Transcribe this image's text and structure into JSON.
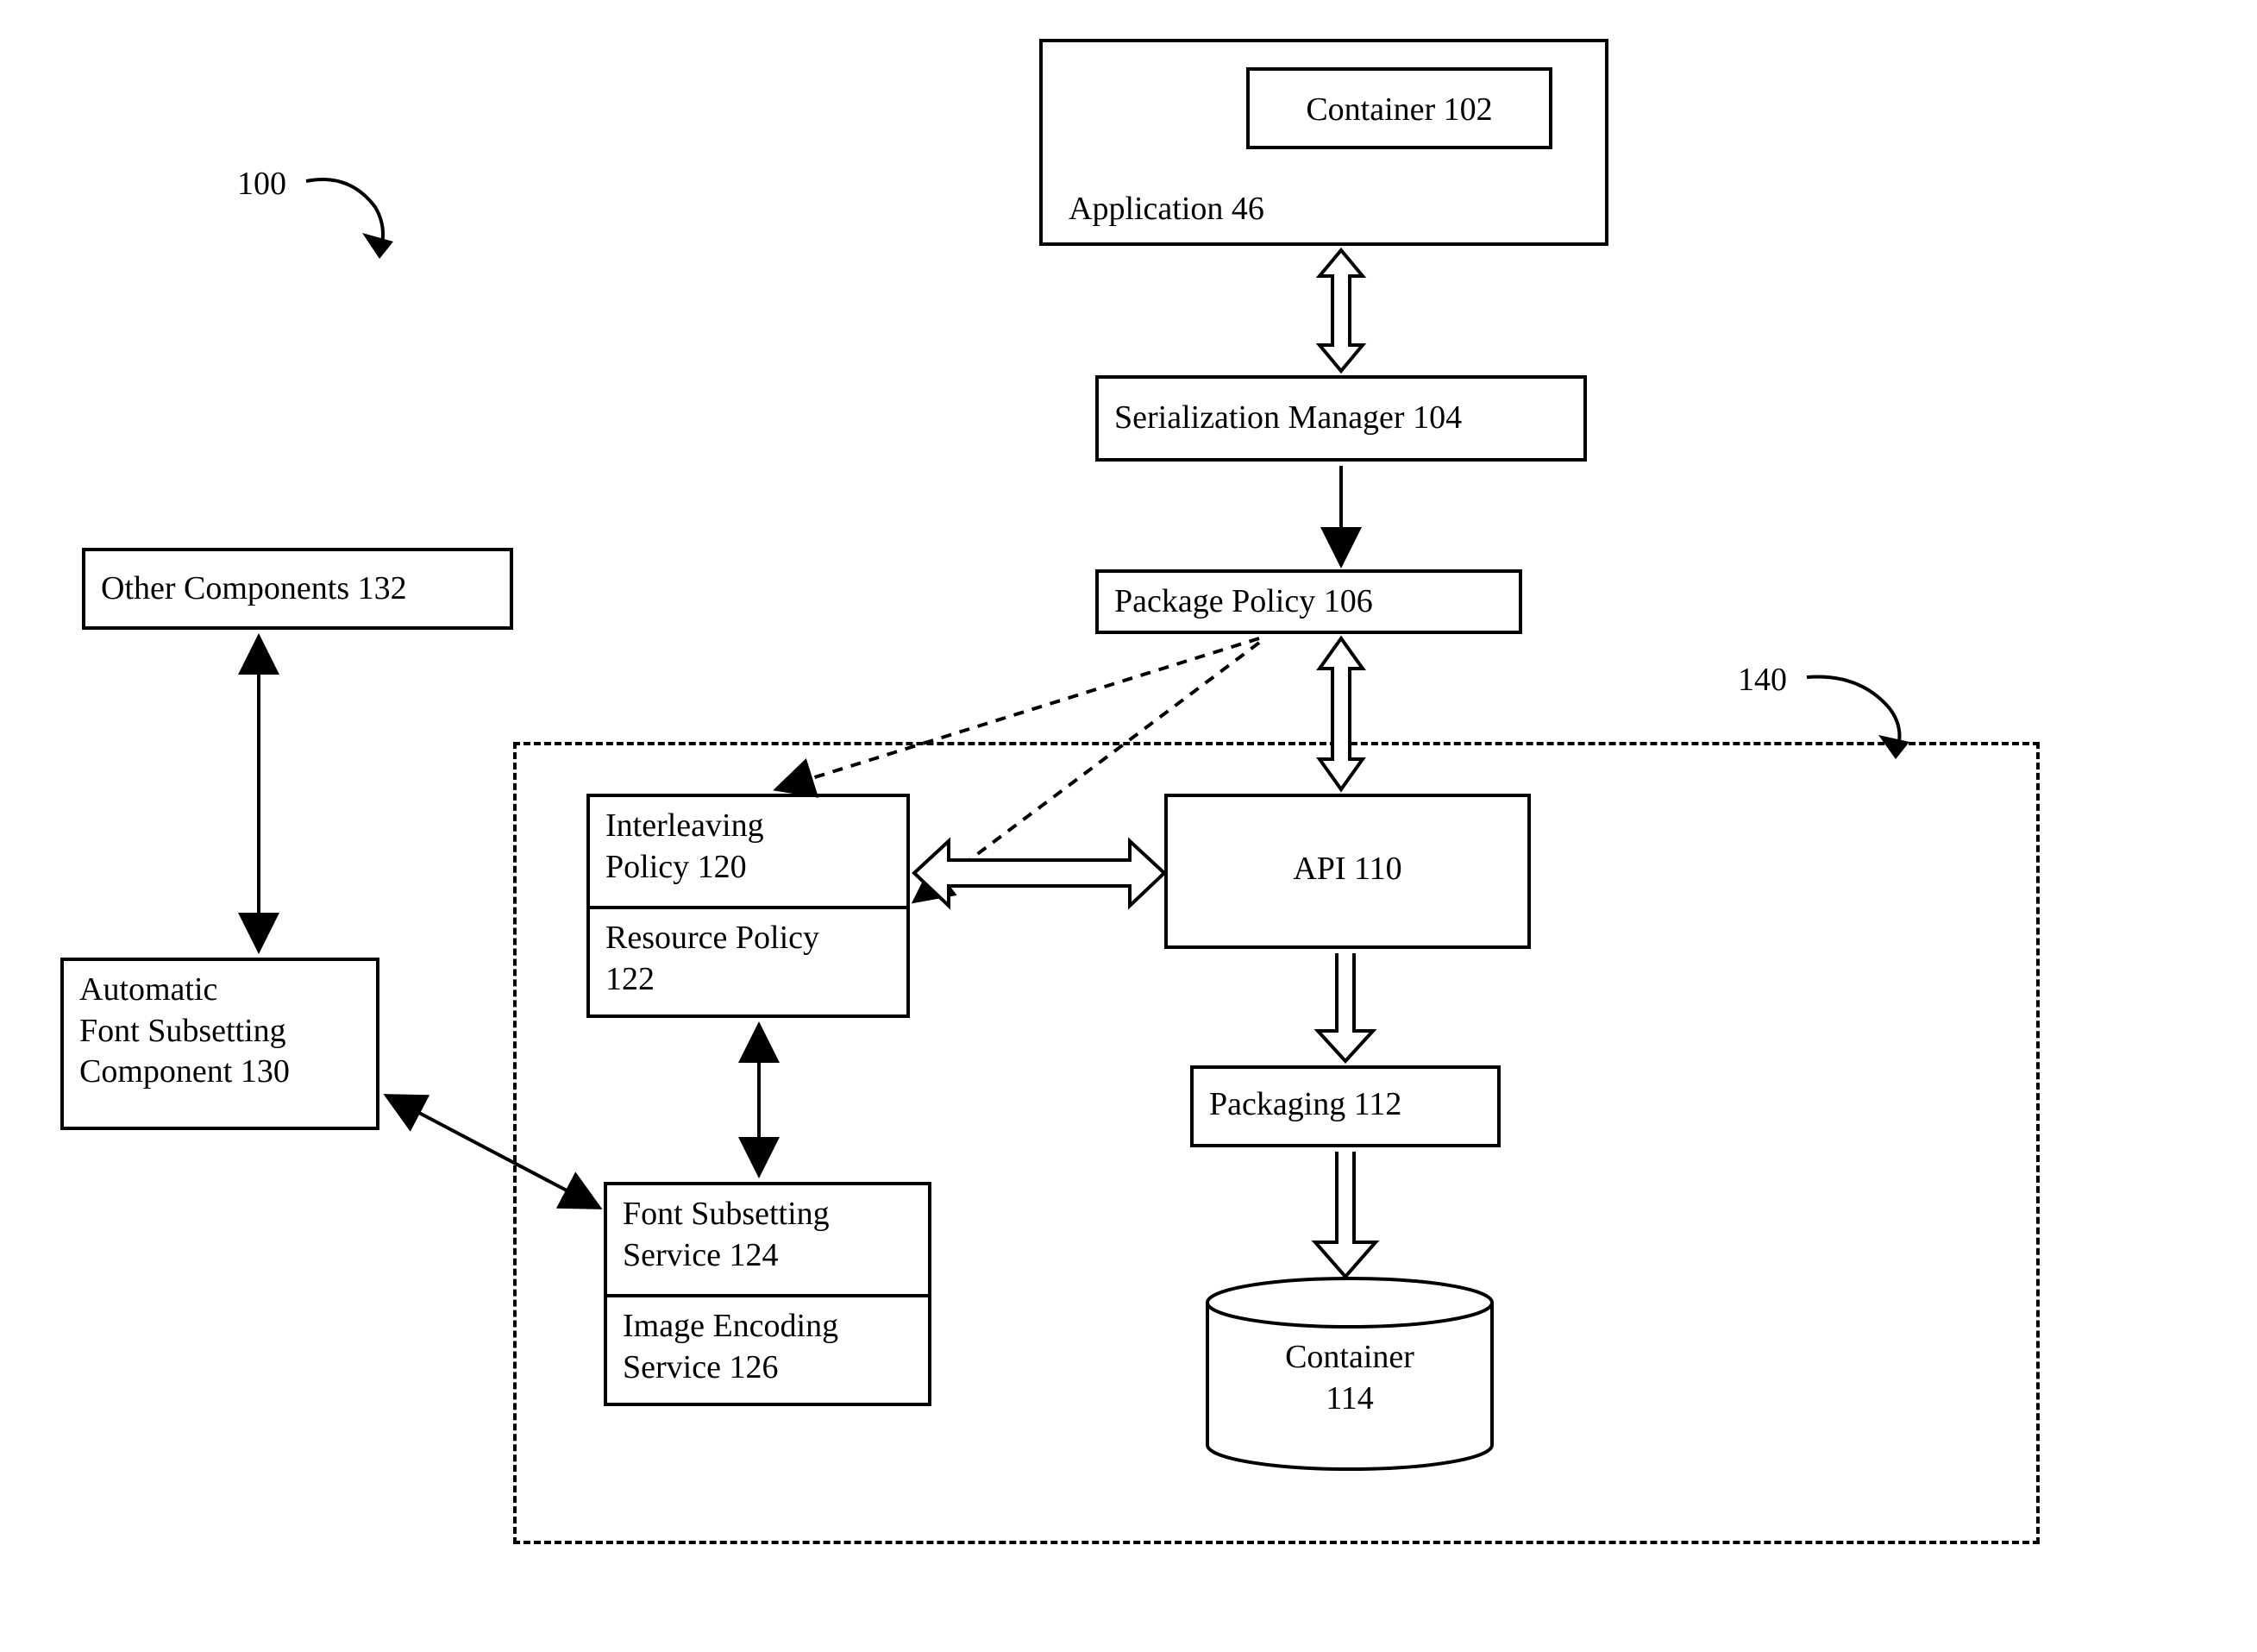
{
  "labels": {
    "figure_ref": "100",
    "dashed_ref": "140"
  },
  "containerBox": {
    "text": "Container 102"
  },
  "applicationBox": {
    "text": "Application 46"
  },
  "serializationManager": {
    "text": "Serialization Manager 104"
  },
  "packagePolicy": {
    "text": "Package Policy 106"
  },
  "otherComponents": {
    "text": "Other Components 132"
  },
  "autoFontSubsetting": {
    "line1": "Automatic",
    "line2": "Font Subsetting",
    "line3": "Component 130"
  },
  "interleavingPolicy": {
    "line1": "Interleaving",
    "line2": "Policy 120"
  },
  "resourcePolicy": {
    "line1": "Resource Policy",
    "line2": "122"
  },
  "fontSubsettingService": {
    "line1": "Font Subsetting",
    "line2": "Service  124"
  },
  "imageEncodingService": {
    "line1": "Image Encoding",
    "line2": "Service 126"
  },
  "api": {
    "text": "API 110"
  },
  "packaging": {
    "text": "Packaging 112"
  },
  "containerCyl": {
    "line1": "Container",
    "line2": "114"
  }
}
